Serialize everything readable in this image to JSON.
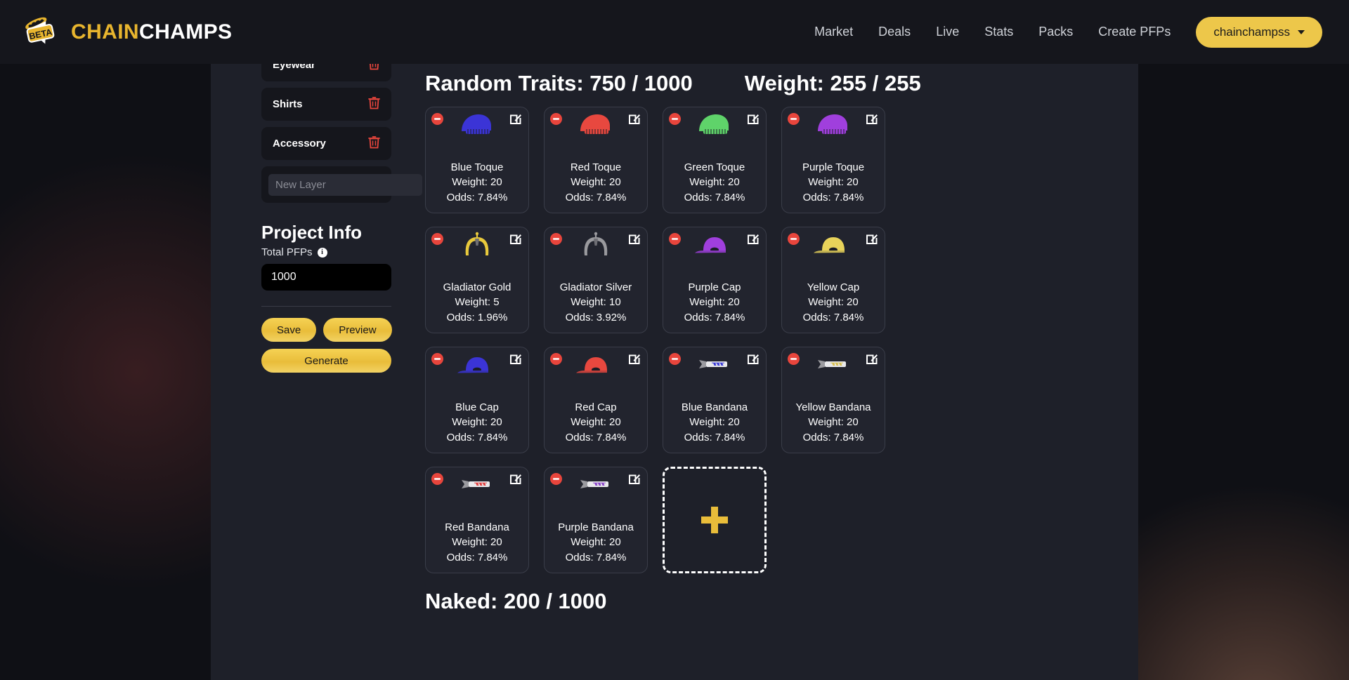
{
  "brand": {
    "badge_text": "BETA",
    "name_part1": "CHAIN",
    "name_part2": "CHAMPS"
  },
  "nav": {
    "links": [
      {
        "label": "Market"
      },
      {
        "label": "Deals"
      },
      {
        "label": "Live"
      },
      {
        "label": "Stats"
      },
      {
        "label": "Packs"
      },
      {
        "label": "Create PFPs"
      }
    ],
    "account_label": "chainchampss"
  },
  "layers": {
    "items": [
      {
        "label": "Eyewear"
      },
      {
        "label": "Shirts"
      },
      {
        "label": "Accessory"
      }
    ],
    "new_layer_placeholder": "New Layer",
    "new_layer_value": ""
  },
  "project_info": {
    "title": "Project Info",
    "total_pfps_label": "Total PFPs",
    "info_glyph": "i",
    "total_pfps_value": "1000",
    "save_label": "Save",
    "preview_label": "Preview",
    "generate_label": "Generate"
  },
  "traits_section": {
    "random_traits_label": "Random Traits: 750 / 1000",
    "weight_label": "Weight: 255 / 255",
    "next_section_label": "Naked: 200 / 1000",
    "cards": [
      {
        "name": "Blue Toque",
        "weight": "Weight: 20",
        "odds": "Odds: 7.84%",
        "art": "toque",
        "color": "#3b34d6"
      },
      {
        "name": "Red Toque",
        "weight": "Weight: 20",
        "odds": "Odds: 7.84%",
        "art": "toque",
        "color": "#e8483f"
      },
      {
        "name": "Green Toque",
        "weight": "Weight: 20",
        "odds": "Odds: 7.84%",
        "art": "toque",
        "color": "#5fd36a"
      },
      {
        "name": "Purple Toque",
        "weight": "Weight: 20",
        "odds": "Odds: 7.84%",
        "art": "toque",
        "color": "#a03fdd"
      },
      {
        "name": "Gladiator Gold",
        "weight": "Weight: 5",
        "odds": "Odds: 1.96%",
        "art": "helmet",
        "color": "#e8c93c"
      },
      {
        "name": "Gladiator Silver",
        "weight": "Weight: 10",
        "odds": "Odds: 3.92%",
        "art": "helmet",
        "color": "#9a9a9e"
      },
      {
        "name": "Purple Cap",
        "weight": "Weight: 20",
        "odds": "Odds: 7.84%",
        "art": "cap",
        "color": "#a03fdd"
      },
      {
        "name": "Yellow Cap",
        "weight": "Weight: 20",
        "odds": "Odds: 7.84%",
        "art": "cap",
        "color": "#e8d35a"
      },
      {
        "name": "Blue Cap",
        "weight": "Weight: 20",
        "odds": "Odds: 7.84%",
        "art": "cap",
        "color": "#3b34d6"
      },
      {
        "name": "Red Cap",
        "weight": "Weight: 20",
        "odds": "Odds: 7.84%",
        "art": "cap",
        "color": "#e8483f"
      },
      {
        "name": "Blue Bandana",
        "weight": "Weight: 20",
        "odds": "Odds: 7.84%",
        "art": "bandana",
        "color": "#3b3ad6"
      },
      {
        "name": "Yellow Bandana",
        "weight": "Weight: 20",
        "odds": "Odds: 7.84%",
        "art": "bandana",
        "color": "#d8c050"
      },
      {
        "name": "Red Bandana",
        "weight": "Weight: 20",
        "odds": "Odds: 7.84%",
        "art": "bandana",
        "color": "#e04040"
      },
      {
        "name": "Purple Bandana",
        "weight": "Weight: 20",
        "odds": "Odds: 7.84%",
        "art": "bandana",
        "color": "#8a45c8"
      }
    ],
    "add_card_glyph": "+"
  },
  "colors": {
    "accent_gold": "#e9bd3a",
    "panel_bg": "#1e2029",
    "card_bg": "#22242e",
    "danger_red": "#e8453c"
  }
}
